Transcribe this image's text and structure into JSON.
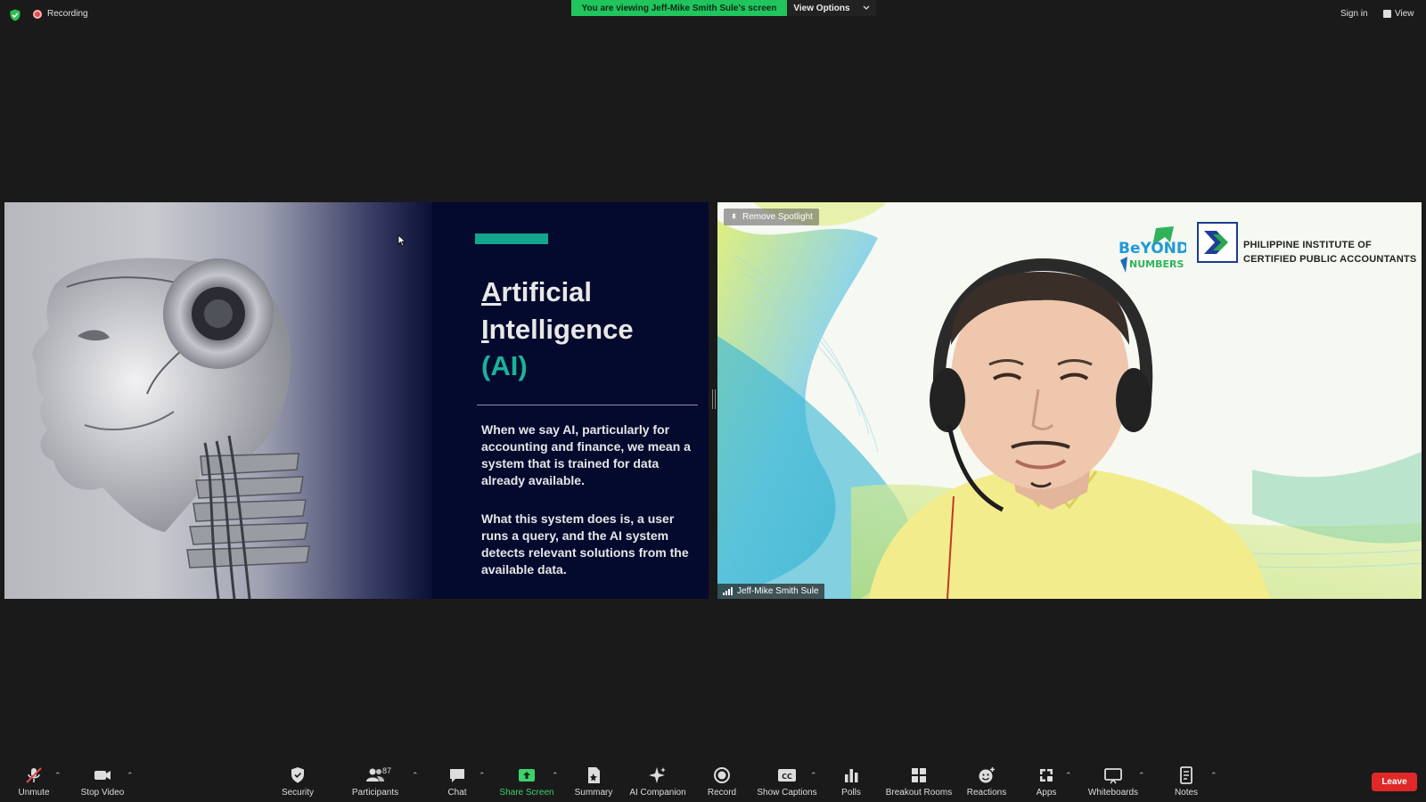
{
  "top": {
    "recording_label": "Recording",
    "viewing_banner": "You are viewing Jeff-Mike Smith Sule's screen",
    "view_options_label": "View Options",
    "sign_in_label": "Sign in",
    "view_label": "View"
  },
  "slide": {
    "title_line1_first": "A",
    "title_line1_rest": "rtificial",
    "title_line2_first": "I",
    "title_line2_rest": "ntelligence",
    "title_line3": "(AI)",
    "paragraph1": "When we say AI, particularly for accounting and finance, we mean a system that is trained for data already available.",
    "paragraph2": "What this system does is, a user runs a query, and the AI system detects relevant solutions from the available data.",
    "accent_color": "#13a58d"
  },
  "video": {
    "spotlight_label": "Remove Spotlight",
    "participant_name": "Jeff-Mike Smith Sule",
    "logo_beyond_line1": "BeYOND",
    "logo_beyond_line2": "NUMBERS",
    "picpa_line1": "PHILIPPINE INSTITUTE OF",
    "picpa_line2": "CERTIFIED PUBLIC ACCOUNTANTS"
  },
  "toolbar": {
    "unmute": "Unmute",
    "stop_video": "Stop Video",
    "security": "Security",
    "participants": "Participants",
    "participants_count": "87",
    "chat": "Chat",
    "share_screen": "Share Screen",
    "summary": "Summary",
    "ai_companion": "AI Companion",
    "record": "Record",
    "show_captions": "Show Captions",
    "captions_icon_text": "CC",
    "polls": "Polls",
    "breakout_rooms": "Breakout Rooms",
    "reactions": "Reactions",
    "apps": "Apps",
    "whiteboards": "Whiteboards",
    "notes": "Notes",
    "leave": "Leave"
  },
  "colors": {
    "share_green": "#3ed06b",
    "leave_red": "#e02828",
    "banner_green": "#21c55d"
  }
}
